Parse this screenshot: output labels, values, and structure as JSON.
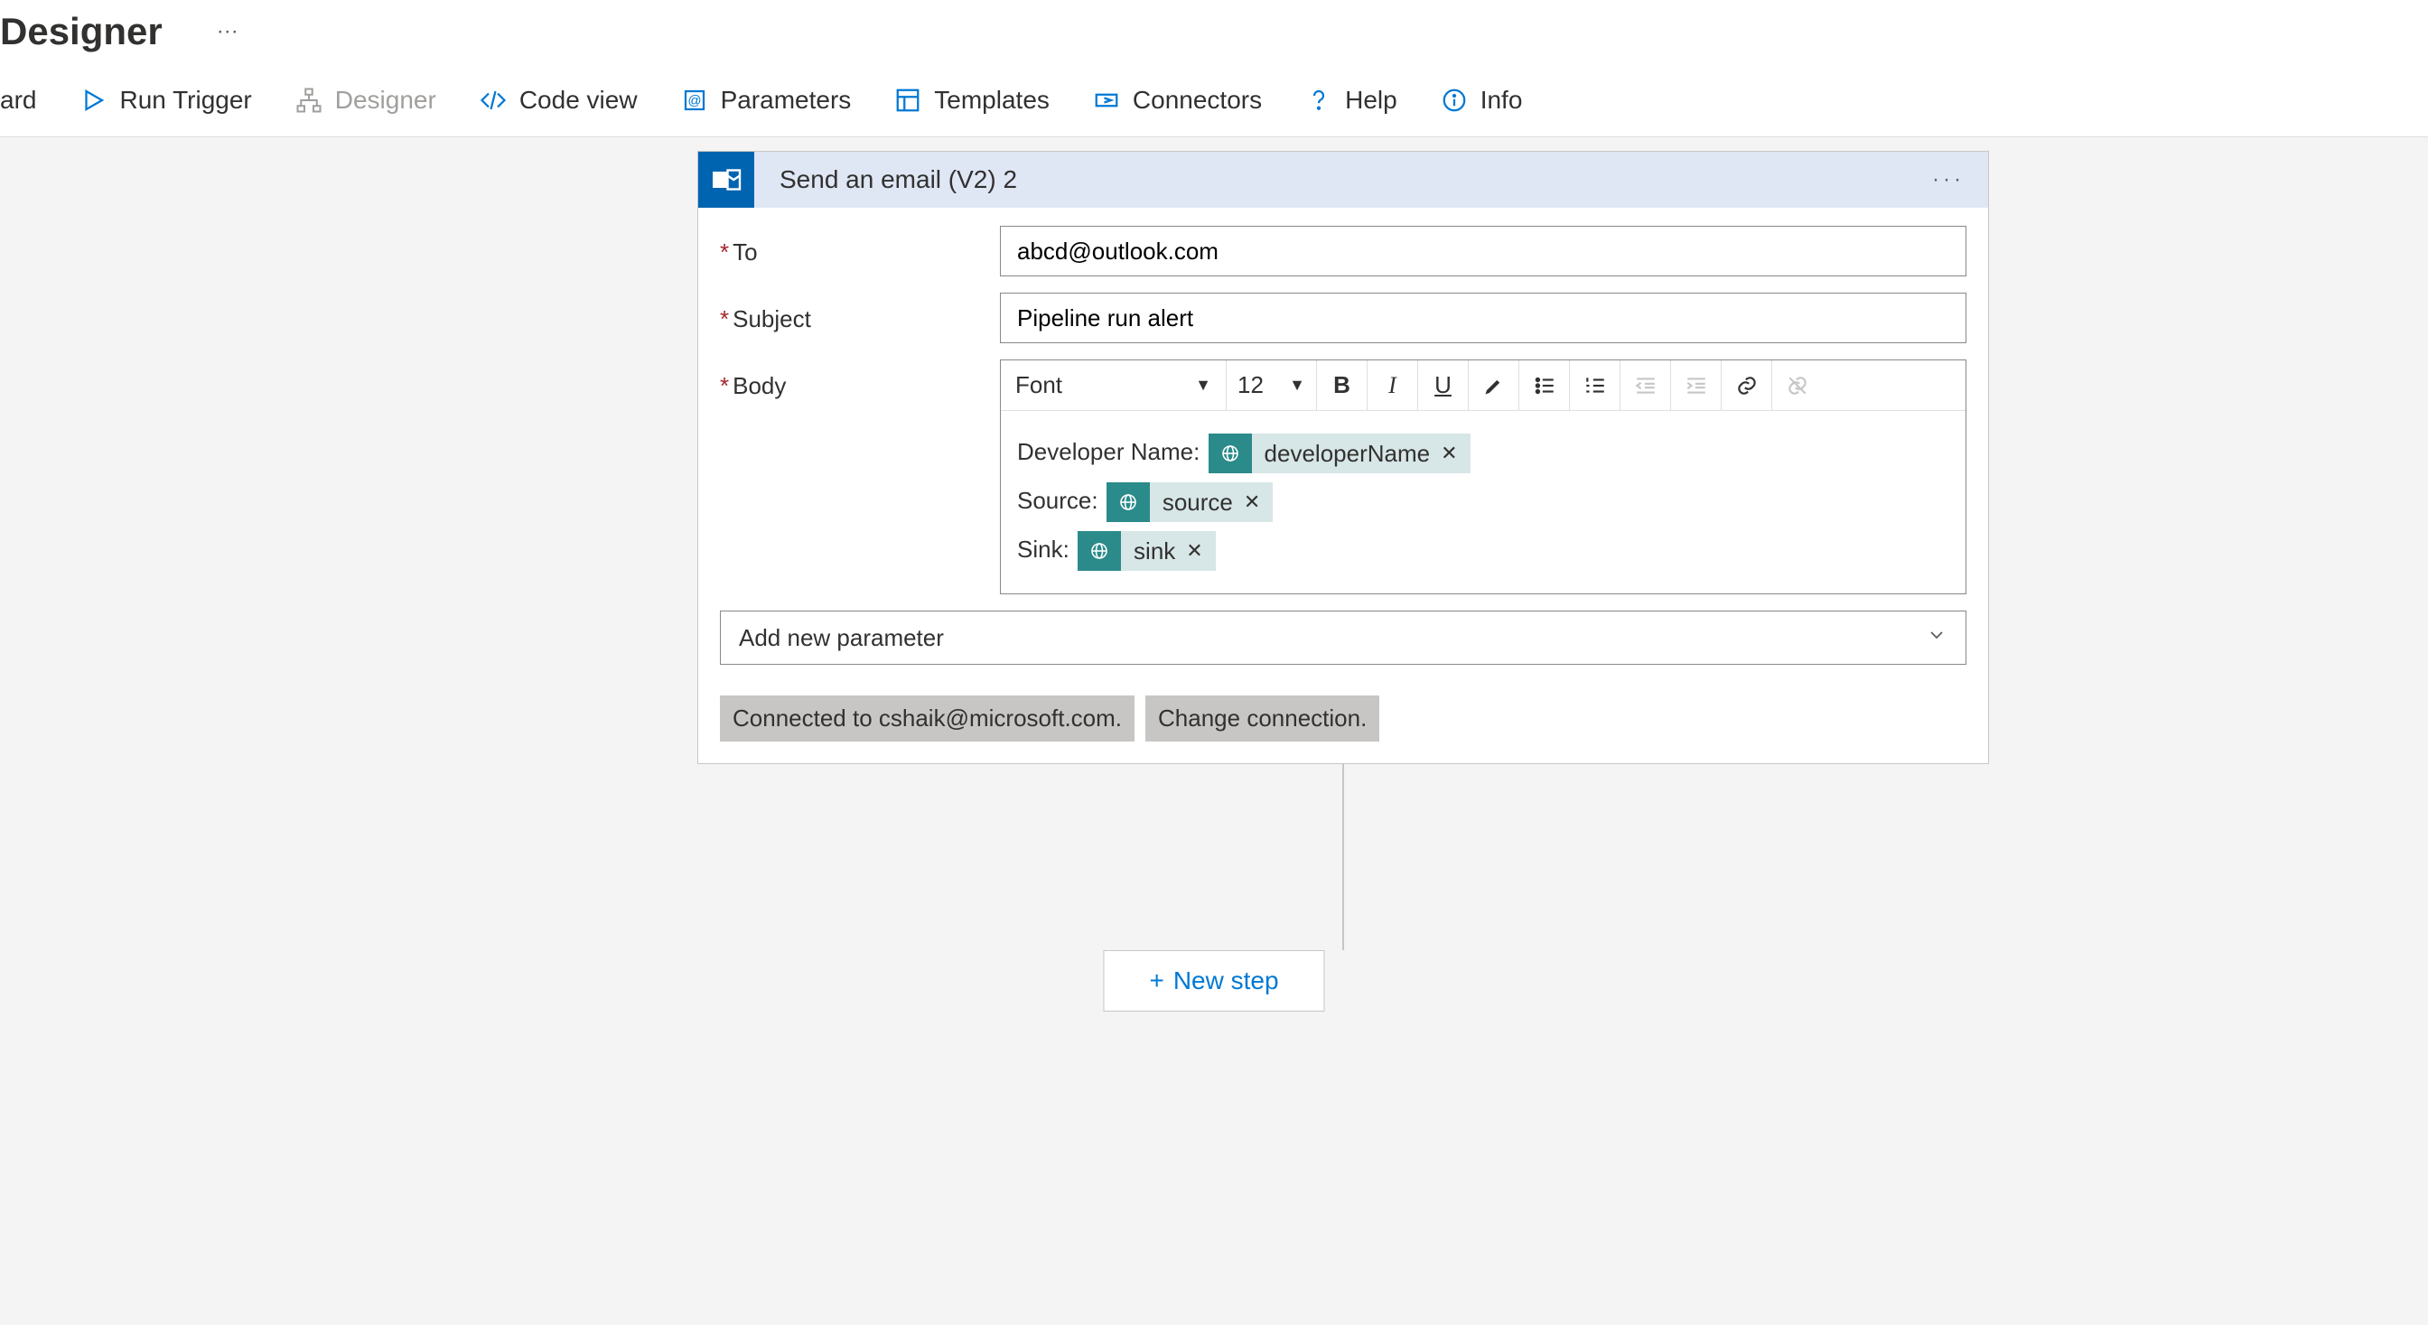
{
  "page": {
    "title": "Designer"
  },
  "commands": {
    "truncated_prev": "ard",
    "run_trigger": "Run Trigger",
    "designer": "Designer",
    "code_view": "Code view",
    "parameters": "Parameters",
    "templates": "Templates",
    "connectors": "Connectors",
    "help": "Help",
    "info": "Info"
  },
  "card": {
    "title": "Send an email (V2) 2",
    "fields": {
      "to_label": "To",
      "to_value": "abcd@outlook.com",
      "subject_label": "Subject",
      "subject_value": "Pipeline run alert",
      "body_label": "Body"
    },
    "rich_text": {
      "font": "Font",
      "size": "12"
    },
    "body_lines": {
      "l1_prefix": "Developer Name:",
      "l1_token": "developerName",
      "l2_prefix": "Source:",
      "l2_token": "source",
      "l3_prefix": "Sink:",
      "l3_token": "sink"
    },
    "add_param": "Add new parameter",
    "connected_to": "Connected to cshaik@microsoft.com.",
    "change_connection": "Change connection."
  },
  "new_step": "New step"
}
